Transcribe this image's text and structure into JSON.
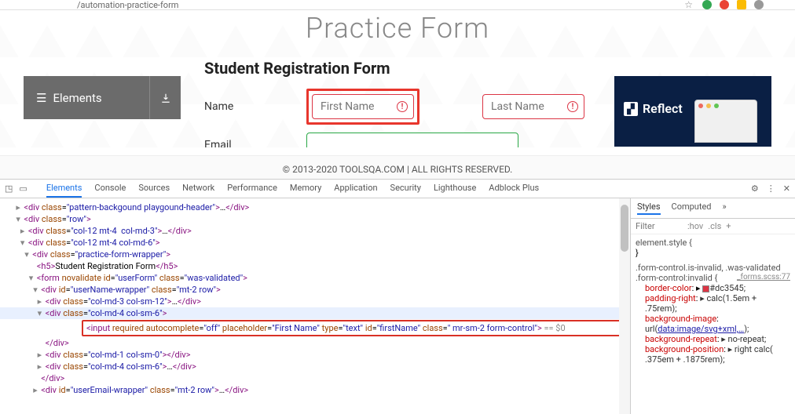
{
  "chrome": {
    "url_fragment": "/automation-practice-form",
    "dots": [
      "#34a853",
      "#ea4335",
      "#fbbc04",
      "#999"
    ]
  },
  "page": {
    "title": "Practice Form",
    "sidebar": {
      "label": "Elements"
    },
    "form": {
      "heading": "Student Registration Form",
      "name_label": "Name",
      "first_name_ph": "First Name",
      "last_name_ph": "Last Name",
      "email_label": "Email"
    },
    "ad": {
      "brand": "Reflect"
    },
    "footer": "© 2013-2020 TOOLSQA.COM | ALL RIGHTS RESERVED."
  },
  "devtools": {
    "tabs": [
      "Elements",
      "Console",
      "Sources",
      "Network",
      "Performance",
      "Memory",
      "Application",
      "Security",
      "Lighthouse",
      "Adblock Plus"
    ],
    "active_tab": "Elements",
    "styles_tabs": [
      "Styles",
      "Computed"
    ],
    "filter_ph": "Filter",
    "hov": ":hov",
    "cls": ".cls",
    "dom": [
      {
        "indent": 3,
        "arrow": "▸",
        "html": "<div class=\"pattern-backgound playgound-header\">…</div>"
      },
      {
        "indent": 3,
        "arrow": "▾",
        "html": "<div class=\"row\">"
      },
      {
        "indent": 4,
        "arrow": "▸",
        "html": "<div class=\"col-12 mt-4  col-md-3\">…</div>"
      },
      {
        "indent": 4,
        "arrow": "▾",
        "html": "<div class=\"col-12 mt-4 col-md-6\">"
      },
      {
        "indent": 5,
        "arrow": "▾",
        "html": "<div class=\"practice-form-wrapper\">"
      },
      {
        "indent": 6,
        "arrow": "",
        "html": "<h5>Student Registration Form</h5>"
      },
      {
        "indent": 6,
        "arrow": "▾",
        "html": "<form novalidate id=\"userForm\" class=\"was-validated\">"
      },
      {
        "indent": 7,
        "arrow": "▾",
        "html": "<div id=\"userName-wrapper\" class=\"mt-2 row\">"
      },
      {
        "indent": 8,
        "arrow": "▸",
        "html": "<div class=\"col-md-3 col-sm-12\">…</div>"
      },
      {
        "indent": 8,
        "arrow": "▾",
        "html": "<div class=\"col-md-4 col-sm-6\">",
        "hl": true
      },
      {
        "indent": 9,
        "arrow": "",
        "sel": true,
        "html": "<input required autocomplete=\"off\" placeholder=\"First Name\" type=\"text\" id=\"firstName\" class=\" mr-sm-2 form-control\"> == $0"
      },
      {
        "indent": 8,
        "arrow": "",
        "html": "</div>"
      },
      {
        "indent": 8,
        "arrow": "▸",
        "html": "<div class=\"col-md-1 col-sm-0\"></div>"
      },
      {
        "indent": 8,
        "arrow": "▸",
        "html": "<div class=\"col-md-4 col-sm-6\">…</div>"
      },
      {
        "indent": 7,
        "arrow": "",
        "html": "</div>"
      },
      {
        "indent": 7,
        "arrow": "▸",
        "html": "<div id=\"userEmail-wrapper\" class=\"mt-2 row\">…</div>"
      }
    ],
    "rules": [
      {
        "sel": "element.style {",
        "props": [],
        "close": "}"
      },
      {
        "sel": ".form-control.is-invalid, .was-validated .form-control:invalid {",
        "link": "_forms.scss:77",
        "props": [
          {
            "n": "border-color",
            "v": "#dc3545",
            "sw": true
          },
          {
            "n": "padding-right",
            "v": "calc(1.5em + .75rem)"
          },
          {
            "n": "background-image",
            "v": "url(",
            "link": "data:image/svg+xml,…",
            "tail": ")"
          },
          {
            "n": "background-repeat",
            "v": "no-repeat"
          },
          {
            "n": "background-position",
            "v": "right calc( .375em + .1875rem)"
          }
        ]
      }
    ]
  }
}
